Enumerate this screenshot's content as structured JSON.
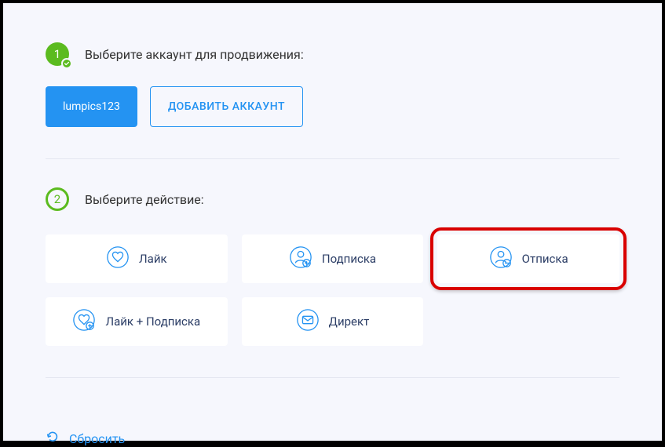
{
  "step1": {
    "number": "1",
    "title": "Выберите аккаунт для продвижения:"
  },
  "accounts": {
    "selected": "lumpics123",
    "add_label": "ДОБАВИТЬ АККАУНТ"
  },
  "step2": {
    "number": "2",
    "title": "Выберите действие:"
  },
  "actions": {
    "like": "Лайк",
    "follow": "Подписка",
    "unfollow": "Отписка",
    "like_follow": "Лайк + Подписка",
    "direct": "Директ"
  },
  "reset_label": "Сбросить"
}
